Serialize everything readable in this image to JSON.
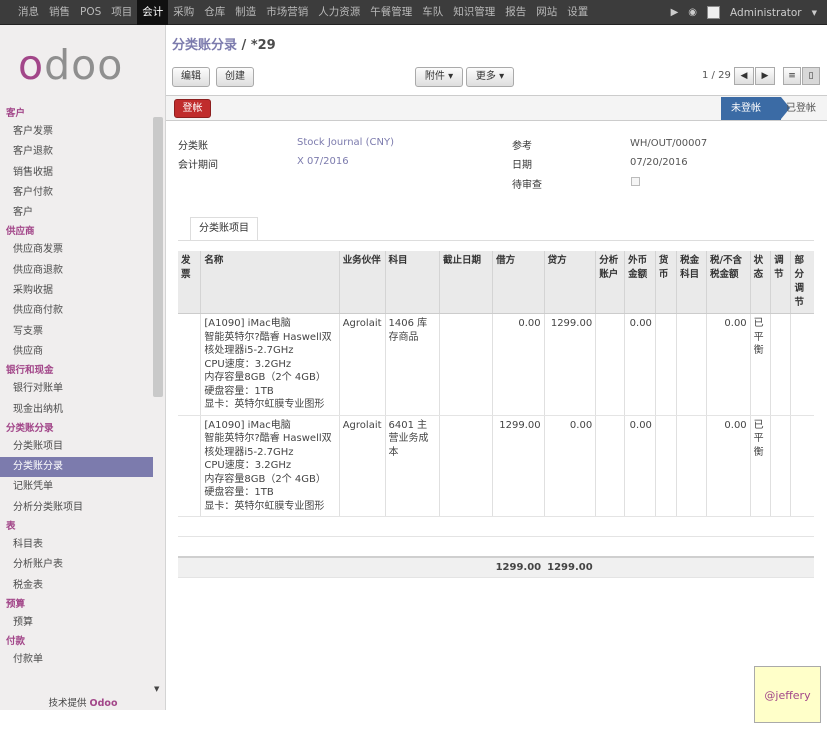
{
  "topbar": {
    "menu": [
      "消息",
      "销售",
      "POS",
      "项目",
      "会计",
      "采购",
      "仓库",
      "制造",
      "市场营销",
      "人力资源",
      "午餐管理",
      "车队",
      "知识管理",
      "报告",
      "网站",
      "设置"
    ],
    "active": "会计",
    "user": "Administrator"
  },
  "sidebar": {
    "logo": "odoo",
    "sections": [
      {
        "title": "客户",
        "items": [
          "客户发票",
          "客户退款",
          "销售收据",
          "客户付款",
          "客户"
        ]
      },
      {
        "title": "供应商",
        "items": [
          "供应商发票",
          "供应商退款",
          "采购收据",
          "供应商付款",
          "写支票",
          "供应商"
        ]
      },
      {
        "title": "银行和现金",
        "items": [
          "银行对账单",
          "现金出纳机"
        ]
      },
      {
        "title": "分类账分录",
        "items": [
          "分类账项目",
          "分类账分录",
          "记账凭单",
          "分析分类账项目"
        ]
      },
      {
        "title": "表",
        "items": [
          "科目表",
          "分析账户表",
          "税金表"
        ]
      },
      {
        "title": "预算",
        "items": [
          "预算"
        ]
      },
      {
        "title": "付款",
        "items": [
          "付款单"
        ]
      }
    ],
    "active_item": "分类账分录",
    "powered_by": "技术提供",
    "powered_brand": "Odoo"
  },
  "header": {
    "breadcrumb_link": "分类账分录",
    "breadcrumb_sep": " / ",
    "breadcrumb_current": "*29",
    "edit_label": "编辑",
    "create_label": "创建",
    "attach_label": "附件",
    "more_label": "更多",
    "pager": "1 / 29"
  },
  "statusbar": {
    "post_label": "登帐",
    "unposted": "未登帐",
    "posted": "已登帐"
  },
  "form": {
    "journal_label": "分类账",
    "journal_value": "Stock Journal (CNY)",
    "period_label": "会计期间",
    "period_value": "X 07/2016",
    "ref_label": "参考",
    "ref_value": "WH/OUT/00007",
    "date_label": "日期",
    "date_value": "07/20/2016",
    "review_label": "待审查"
  },
  "tab": {
    "label": "分类账项目"
  },
  "table": {
    "headers": [
      "发票",
      "名称",
      "业务伙伴",
      "科目",
      "截止日期",
      "借方",
      "贷方",
      "分析账户",
      "外币金额",
      "货币",
      "税金科目",
      "税/不含税金额",
      "状态",
      "调节",
      "部分调节"
    ],
    "rows": [
      {
        "name_lines": [
          "[A1090] iMac电脑",
          "智能英特尔?酷睿 Haswell双",
          "核处理器i5-2.7GHz",
          "CPU速度：3.2GHz",
          "内存容量8GB（2个 4GB）",
          "硬盘容量：1TB",
          "显卡：英特尔虹膜专业图形"
        ],
        "partner": "Agrolait",
        "account": "1406 库存商品",
        "debit": "0.00",
        "credit": "1299.00",
        "amount_currency": "0.00",
        "tax_amount": "0.00",
        "state": "已平衡"
      },
      {
        "name_lines": [
          "[A1090] iMac电脑",
          "智能英特尔?酷睿 Haswell双",
          "核处理器i5-2.7GHz",
          "CPU速度：3.2GHz",
          "内存容量8GB（2个 4GB）",
          "硬盘容量：1TB",
          "显卡：英特尔虹膜专业图形"
        ],
        "partner": "Agrolait",
        "account": "6401 主营业务成本",
        "debit": "1299.00",
        "credit": "0.00",
        "amount_currency": "0.00",
        "tax_amount": "0.00",
        "state": "已平衡"
      }
    ],
    "total_debit": "1299.00",
    "total_credit": "1299.00"
  },
  "watermark": "@jeffery"
}
